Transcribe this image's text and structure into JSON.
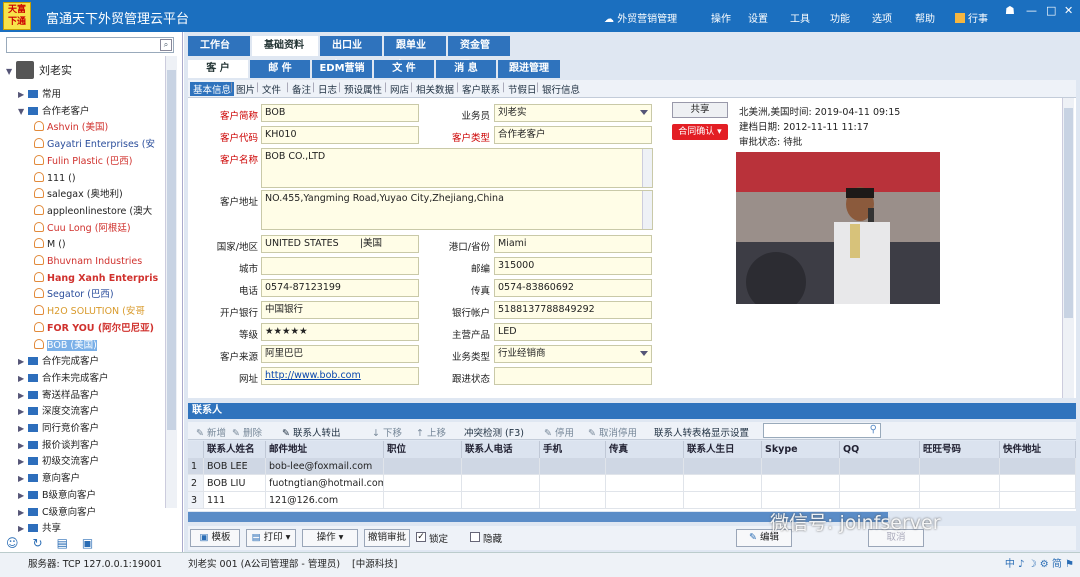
{
  "app": {
    "logo_text": "天富 下通",
    "title": "富通天下外贸管理云平台",
    "cloud_link": "外贸营销管理",
    "menu": [
      "操作",
      "设置",
      "工具",
      "功能",
      "选项",
      "帮助",
      "行事"
    ],
    "window_controls": [
      "☗",
      "—",
      "□",
      "✕"
    ]
  },
  "sidebar": {
    "search_placeholder": "",
    "user": "刘老实",
    "nodes": [
      {
        "label": "常用",
        "type": "folder",
        "level": 1,
        "color": "#222"
      },
      {
        "label": "合作老客户",
        "type": "folder-open",
        "level": 1,
        "color": "#222"
      },
      {
        "label": "Ashvin (美国)",
        "type": "person",
        "level": 2,
        "color": "#d0312d"
      },
      {
        "label": "Gayatri Enterprises (安",
        "type": "person",
        "level": 2,
        "color": "#2a4d9b"
      },
      {
        "label": "Fulin Plastic (巴西)",
        "type": "person",
        "level": 2,
        "color": "#d0312d"
      },
      {
        "label": "111 ()",
        "type": "person",
        "level": 2,
        "color": "#222"
      },
      {
        "label": "salegax (奥地利)",
        "type": "person",
        "level": 2,
        "color": "#222"
      },
      {
        "label": "appleonlinestore (澳大",
        "type": "person",
        "level": 2,
        "color": "#222"
      },
      {
        "label": "Cuu Long (阿根廷)",
        "type": "person",
        "level": 2,
        "color": "#d0312d"
      },
      {
        "label": "M ()",
        "type": "person",
        "level": 2,
        "color": "#222"
      },
      {
        "label": "Bhuvnam Industries",
        "type": "person",
        "level": 2,
        "color": "#d0312d"
      },
      {
        "label": "Hang Xanh Enterpris",
        "type": "person",
        "level": 2,
        "color": "#d0312d",
        "bold": true
      },
      {
        "label": "Segator (巴西)",
        "type": "person",
        "level": 2,
        "color": "#2a4d9b"
      },
      {
        "label": "H2O SOLUTION (安哥",
        "type": "person",
        "level": 2,
        "color": "#d99a2b"
      },
      {
        "label": "FOR YOU (阿尔巴尼亚)",
        "type": "person",
        "level": 2,
        "color": "#d0312d",
        "bold": true
      },
      {
        "label": "BOB (美国)",
        "type": "person",
        "level": 2,
        "color": "#fff",
        "selected": true
      },
      {
        "label": "合作完成客户",
        "type": "folder",
        "level": 1,
        "color": "#222"
      },
      {
        "label": "合作未完成客户",
        "type": "folder",
        "level": 1,
        "color": "#222"
      },
      {
        "label": "寄送样品客户",
        "type": "folder",
        "level": 1,
        "color": "#222"
      },
      {
        "label": "深度交流客户",
        "type": "folder",
        "level": 1,
        "color": "#222"
      },
      {
        "label": "同行竞价客户",
        "type": "folder",
        "level": 1,
        "color": "#222"
      },
      {
        "label": "报价谈判客户",
        "type": "folder",
        "level": 1,
        "color": "#222"
      },
      {
        "label": "初级交流客户",
        "type": "folder",
        "level": 1,
        "color": "#222"
      },
      {
        "label": "意向客户",
        "type": "folder",
        "level": 1,
        "color": "#222"
      },
      {
        "label": "B级意向客户",
        "type": "folder",
        "level": 1,
        "color": "#222"
      },
      {
        "label": "C级意向客户",
        "type": "folder",
        "level": 1,
        "color": "#222"
      },
      {
        "label": "共享",
        "type": "folder",
        "level": 1,
        "color": "#222"
      }
    ]
  },
  "tabs_main": [
    "工作台",
    "基础资料",
    "出口业务",
    "跟单业务",
    "资金管理"
  ],
  "tabs_sub": [
    "客 户",
    "邮 件",
    "EDM营销",
    "文 件",
    "消 息",
    "跟进管理"
  ],
  "tabs_detail": [
    "基本信息",
    "图片",
    "文件",
    "备注",
    "日志",
    "预设属性",
    "网店",
    "相关数据",
    "客户联系",
    "节假日",
    "银行信息"
  ],
  "form": {
    "short_name": {
      "label": "客户简称",
      "value": "BOB"
    },
    "code": {
      "label": "客户代码",
      "value": "KH010"
    },
    "name": {
      "label": "客户名称",
      "value": "BOB CO.,LTD"
    },
    "address": {
      "label": "客户地址",
      "value": "NO.455,Yangming Road,Yuyao City,Zhejiang,China"
    },
    "country": {
      "label": "国家/地区",
      "value": "UNITED STATES",
      "value2": "|美国"
    },
    "city": {
      "label": "城市",
      "value": ""
    },
    "phone": {
      "label": "电话",
      "value": "0574-87123199"
    },
    "bank": {
      "label": "开户银行",
      "value": "中国银行"
    },
    "grade": {
      "label": "等级",
      "value": "★★★★★"
    },
    "source": {
      "label": "客户来源",
      "value": "阿里巴巴"
    },
    "website": {
      "label": "网址",
      "value": "http://www.bob.com"
    },
    "salesman": {
      "label": "业务员",
      "value": "刘老实"
    },
    "customer_type": {
      "label": "客户类型",
      "value": "合作老客户"
    },
    "port": {
      "label": "港口/省份",
      "value": "Miami"
    },
    "zip": {
      "label": "邮编",
      "value": "315000"
    },
    "fax": {
      "label": "传真",
      "value": "0574-83860692"
    },
    "bank_account": {
      "label": "银行帐户",
      "value": "5188137788849292"
    },
    "product": {
      "label": "主营产品",
      "value": "LED"
    },
    "business_type": {
      "label": "业务类型",
      "value": "行业经销商"
    },
    "follow_status": {
      "label": "跟进状态",
      "value": ""
    },
    "share_button": "共享",
    "contract_button": "合同确认",
    "local_time": "北美洲,美国时间: 2019-04-11 09:15",
    "created": "建档日期: 2012-11-11 11:17",
    "approval": "审批状态: 待批"
  },
  "contacts": {
    "title": "联系人",
    "toolbar": [
      "新增",
      "删除",
      "联系人转出",
      "下移",
      "上移",
      "冲突检测 (F3)",
      "停用",
      "取消停用",
      "联系人转表格显示设置"
    ],
    "columns": [
      "联系人姓名",
      "邮件地址",
      "职位",
      "联系人电话",
      "手机",
      "传真",
      "联系人生日",
      "Skype",
      "QQ",
      "旺旺号码",
      "快件地址"
    ],
    "rows": [
      {
        "n": "1",
        "name": "BOB LEE",
        "email": "bob-lee@foxmail.com"
      },
      {
        "n": "2",
        "name": "BOB LIU",
        "email": "fuotngtian@hotmail.com"
      },
      {
        "n": "3",
        "name": "111",
        "email": "121@126.com"
      }
    ]
  },
  "bottom": {
    "template": "模板",
    "print": "打印",
    "operate": "操作",
    "revoke": "撤销审批",
    "lock": "锁定",
    "hide": "隐藏",
    "edit": "编辑",
    "cancel": "取消"
  },
  "status": {
    "server": "服务器: TCP  127.0.0.1:19001",
    "user": "刘老实 001 (A公司管理部 - 管理员)",
    "company": "[中源科技]"
  },
  "watermark": "微信号: joinfserver"
}
